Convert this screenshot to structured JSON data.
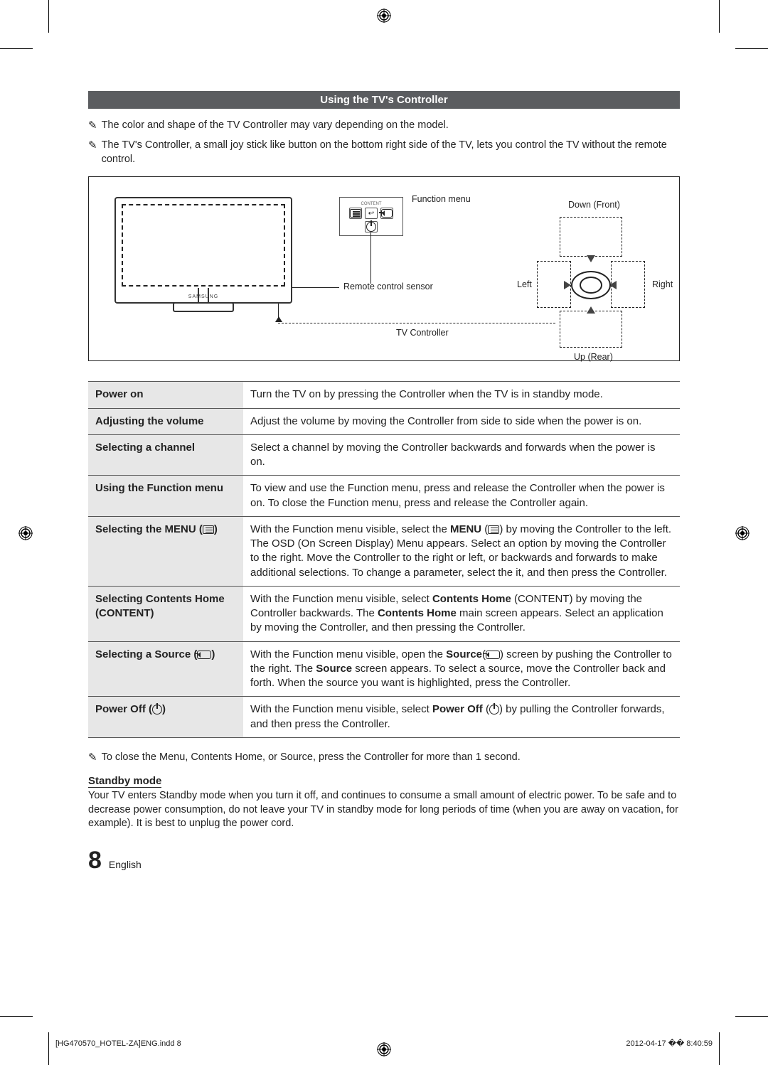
{
  "header": {
    "title": "Using the TV's Controller"
  },
  "notes": {
    "n1": "The color and shape of the TV Controller may vary depending on the model.",
    "n2": "The TV's Controller, a small joy stick like button on the bottom right side of the TV, lets you control the TV without the remote control."
  },
  "diagram": {
    "function_menu": "Function menu",
    "content_label": "CONTENT",
    "remote_sensor": "Remote control sensor",
    "tv_controller": "TV Controller",
    "down": "Down (Front)",
    "up": "Up (Rear)",
    "left": "Left",
    "right": "Right",
    "logo": "SAMSUNG"
  },
  "table": {
    "rows": [
      {
        "k": "Power on",
        "v": "Turn the TV on by pressing the Controller when the TV is in standby mode."
      },
      {
        "k": "Adjusting the volume",
        "v": "Adjust the volume by moving the Controller from side to side when the power is on."
      },
      {
        "k": "Selecting a channel",
        "v": "Select a channel by moving the Controller backwards and forwards when the power is on."
      },
      {
        "k": "Using the Function menu",
        "v": "To view and use the Function menu, press and release the Controller when the power is on. To close the Function menu, press and release the Controller again."
      },
      {
        "k": "Selecting the MENU (",
        "k2": ")",
        "v1": "With the Function menu visible, select the ",
        "vb": "MENU",
        "v2": " (",
        "v3": ") by moving the Controller to the left. The OSD (On Screen Display) Menu appears. Select an option by moving the Controller to the right. Move the Controller to the right or left, or backwards and forwards to make additional selections. To change a parameter, select the it, and then press the Controller."
      },
      {
        "k": "Selecting Contents Home (",
        "kcaps": "CONTENT",
        "k2": ")",
        "v1": "With the Function menu visible, select ",
        "vb": "Contents Home",
        "v2": " (",
        "vcaps": "CONTENT",
        "v3": ") by moving the Controller backwards. The ",
        "vb2": "Contents Home",
        "v4": " main screen appears. Select an application by moving the Controller, and then pressing the Controller."
      },
      {
        "k": "Selecting a Source (",
        "k2": ")",
        "v1": "With the Function menu visible, open the ",
        "vb": "Source",
        "v2": "(",
        "v3": ") screen by pushing the Controller to the right. The ",
        "vb2": "Source",
        "v4": " screen appears. To select a source, move the Controller back and forth. When the source you want is highlighted, press the Controller."
      },
      {
        "k": "Power Off (",
        "k2": ")",
        "v1": "With the Function menu visible, select ",
        "vb": "Power Off",
        "v2": " (",
        "v3": ") by pulling the Controller forwards, and then press the Controller."
      }
    ]
  },
  "bottom": {
    "close_note": "To close the Menu, Contents Home, or Source, press the Controller for more than 1 second.",
    "standby_head": "Standby mode",
    "standby_body": "Your TV enters Standby mode when you turn it off, and continues to consume a small amount of electric power. To be safe and to decrease power consumption, do not leave your TV in standby mode for long periods of time (when you are away on vacation, for example). It is best to unplug the power cord."
  },
  "footer": {
    "page": "8",
    "lang": "English",
    "left": "[HG470570_HOTEL-ZA]ENG.indd   8",
    "right": "2012-04-17   �� 8:40:59"
  }
}
